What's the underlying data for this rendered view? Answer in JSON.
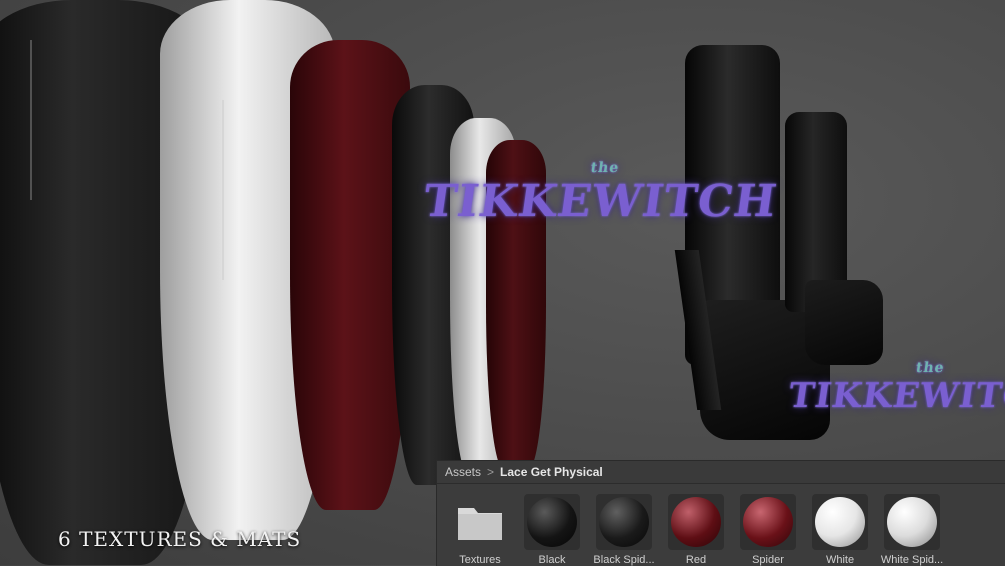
{
  "caption": "6 TEXTURES & MATS",
  "watermark": {
    "small": "the",
    "main": "TIKKEWITCH"
  },
  "breadcrumb": {
    "root": "Assets",
    "separator": ">",
    "current": "Lace Get Physical"
  },
  "assets": [
    {
      "label": "Textures",
      "type": "folder"
    },
    {
      "label": "Black",
      "color": "#141414"
    },
    {
      "label": "Black Spid...",
      "color": "#1a1a1a"
    },
    {
      "label": "Red",
      "color": "#5e0e14"
    },
    {
      "label": "Spider",
      "color": "#6a1118"
    },
    {
      "label": "White",
      "color": "#e6e6e6"
    },
    {
      "label": "White Spid...",
      "color": "#dcdcdc"
    }
  ]
}
